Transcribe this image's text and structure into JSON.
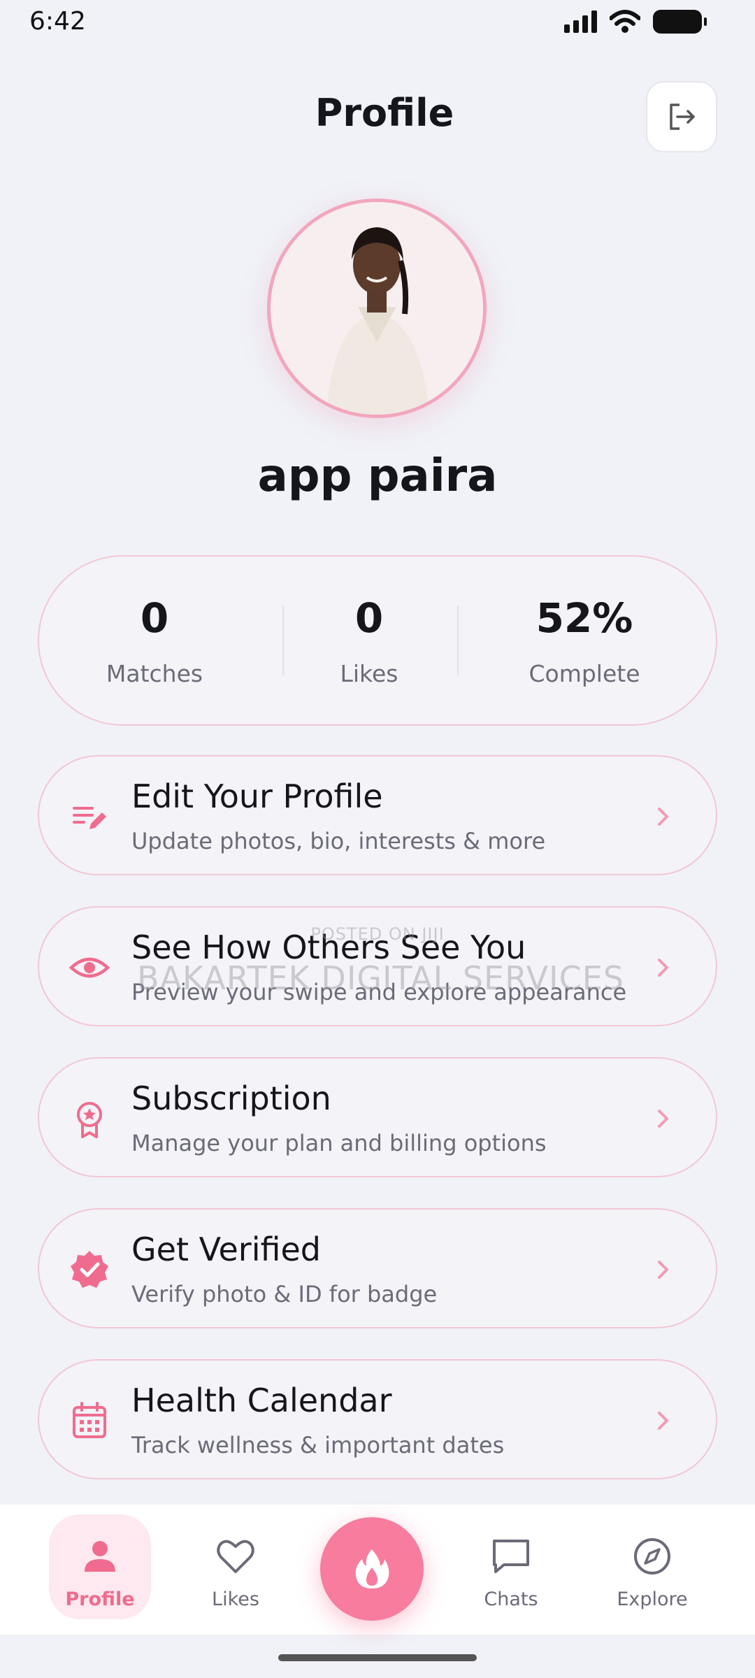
{
  "status_bar": {
    "time": "6:42"
  },
  "header": {
    "title": "Profile",
    "logout_icon": "logout-icon"
  },
  "profile": {
    "name": "app paira",
    "avatar": "user-avatar-photo"
  },
  "stats": [
    {
      "value": "0",
      "label": "Matches"
    },
    {
      "value": "0",
      "label": "Likes"
    },
    {
      "value": "52%",
      "label": "Complete"
    }
  ],
  "menu": [
    {
      "title": "Edit Your Profile",
      "subtitle": "Update photos, bio, interests & more",
      "icon": "edit-notes-icon"
    },
    {
      "title": "See How Others See You",
      "subtitle": "Preview your swipe and explore appearance",
      "icon": "eye-icon"
    },
    {
      "title": "Subscription",
      "subtitle": "Manage your plan and billing options",
      "icon": "badge-icon"
    },
    {
      "title": "Get Verified",
      "subtitle": "Verify photo & ID for badge",
      "icon": "verified-icon"
    },
    {
      "title": "Health Calendar",
      "subtitle": "Track wellness & important dates",
      "icon": "calendar-icon"
    }
  ],
  "watermark": {
    "line1": "POSTED ON JIJI",
    "line2": "BAKARTEK DIGITAL SERVICES"
  },
  "bottom_nav": {
    "items": [
      {
        "label": "Profile",
        "icon": "person-icon",
        "active": true
      },
      {
        "label": "Likes",
        "icon": "heart-icon",
        "active": false
      },
      {
        "label": "Chats",
        "icon": "chat-icon",
        "active": false
      },
      {
        "label": "Explore",
        "icon": "compass-icon",
        "active": false
      }
    ],
    "center_icon": "flame-icon"
  },
  "colors": {
    "accent": "#f06c8e",
    "fab": "#f77c9d",
    "background": "#f0f2f8",
    "card_border": "#f3c7d4"
  }
}
